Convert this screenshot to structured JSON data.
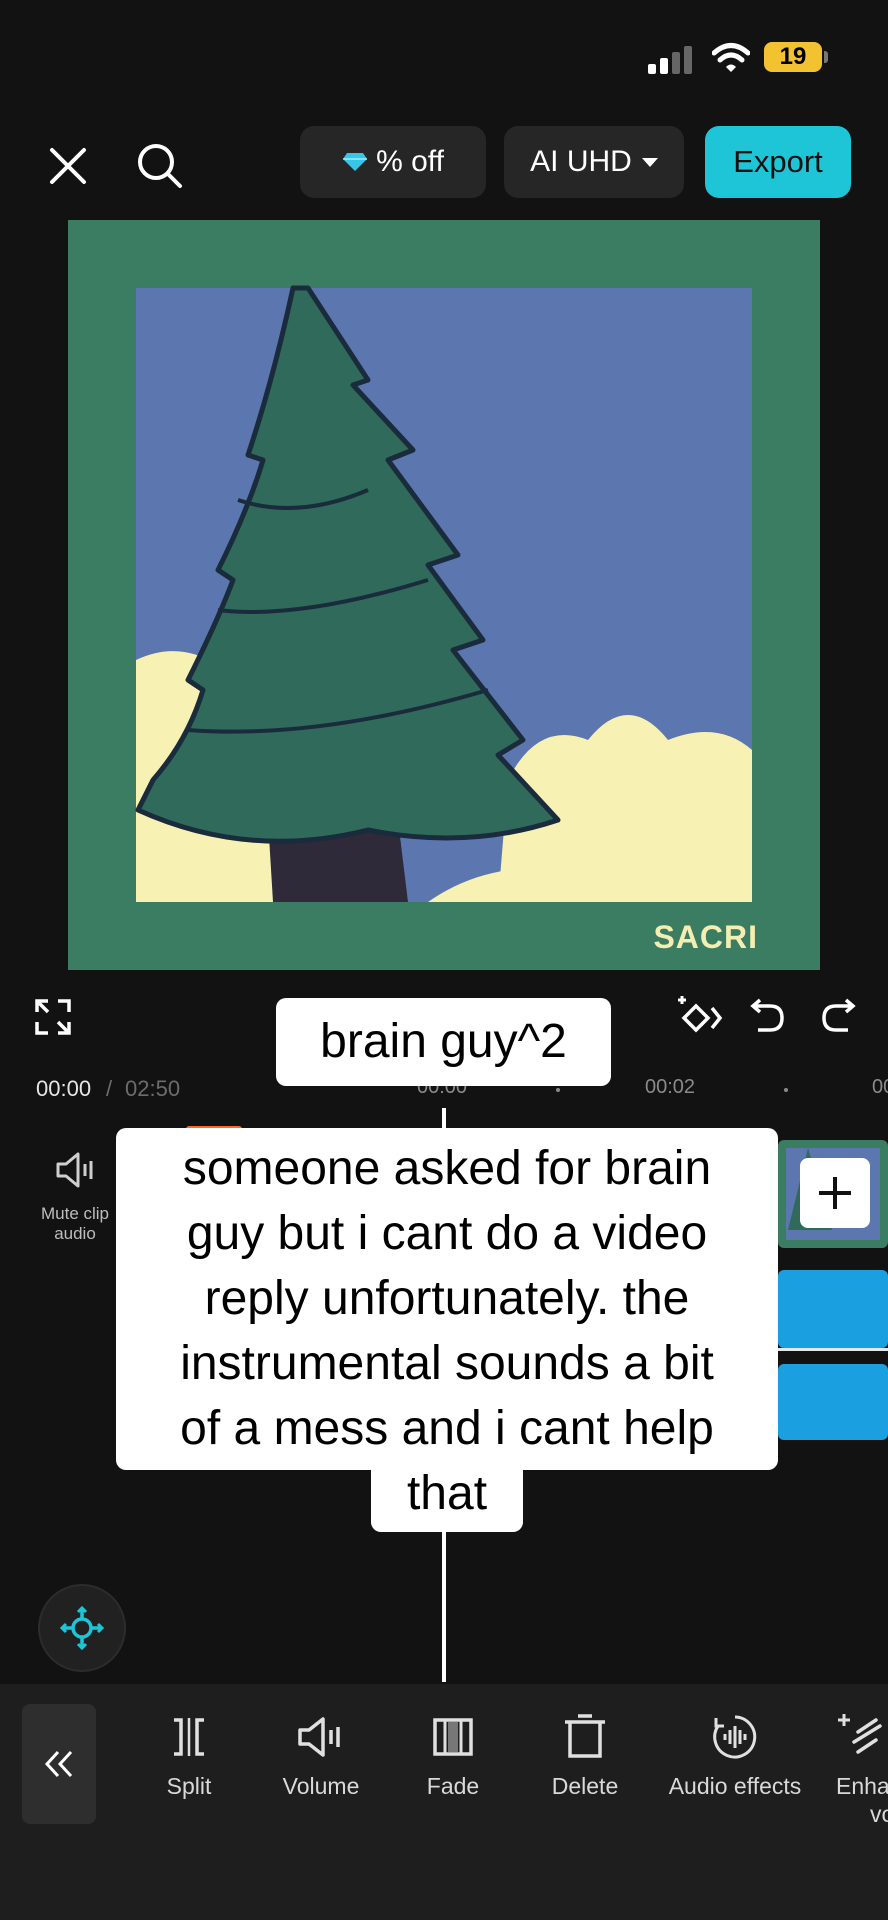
{
  "status_bar": {
    "battery": "19",
    "icons": [
      "signal-icon",
      "wifi-icon",
      "battery-icon"
    ]
  },
  "top_bar": {
    "promo_label": "% off",
    "quality_label": "AI UHD",
    "export_label": "Export",
    "icons": [
      "close-icon",
      "search-icon",
      "diamond-icon",
      "caret-down-icon"
    ]
  },
  "preview": {
    "watermark": "SACRI"
  },
  "captions": {
    "title": "brain guy^2",
    "body_lines": [
      "someone asked for brain",
      "guy but i cant do a video",
      "reply unfortunately. the",
      "instrumental sounds a bit",
      "of a mess and i cant help",
      "that"
    ]
  },
  "timeline": {
    "current_time": "00:00",
    "separator": "/",
    "total_time": "02:50",
    "ticks": [
      "00:00",
      "00:02",
      "00"
    ],
    "mute_label_line1": "Mute clip",
    "mute_label_line2": "audio"
  },
  "toolbar": {
    "items": [
      {
        "label": "Split",
        "icon": "split-icon"
      },
      {
        "label": "Volume",
        "icon": "volume-icon"
      },
      {
        "label": "Fade",
        "icon": "fade-icon"
      },
      {
        "label": "Delete",
        "icon": "delete-icon"
      },
      {
        "label": "Audio effects",
        "icon": "audio-effects-icon"
      },
      {
        "label": "Enha",
        "label2": "voi",
        "icon": "enhance-voice-icon"
      }
    ]
  },
  "colors": {
    "accent": "#1ec5d6",
    "background": "#121212",
    "audio_track": "#1a9fe0",
    "preview_frame": "#3b7d62"
  }
}
